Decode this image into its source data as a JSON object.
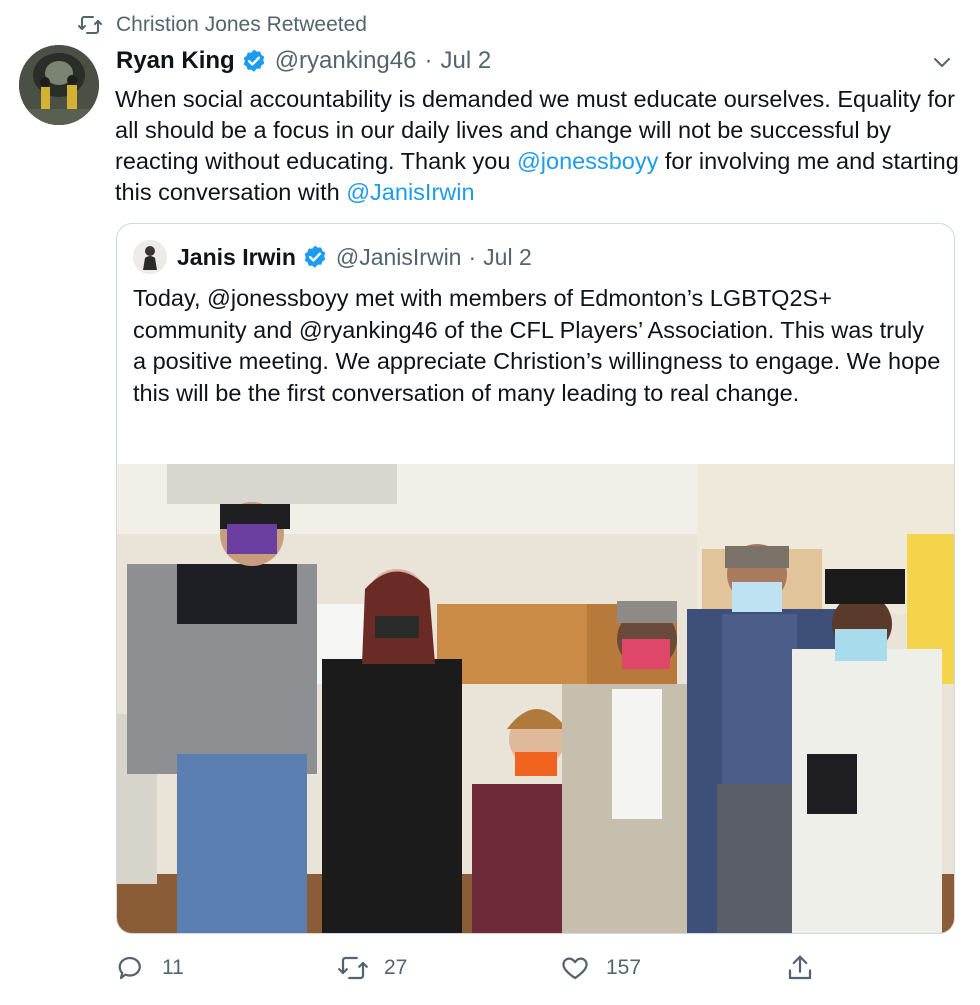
{
  "retweet": {
    "text": "Christion Jones Retweeted",
    "icon": "retweet-icon"
  },
  "tweet": {
    "author_name": "Ryan King",
    "handle": "@ryanking46",
    "separator": "·",
    "date": "Jul 2",
    "text_parts": [
      "When social accountability is demanded we must educate ourselves. Equality for all should be a focus in our daily lives and change will not be successful by reacting without educating. Thank you ",
      "@jonessboyy",
      " for involving me and starting this conversation with ",
      "@JanisIrwin"
    ]
  },
  "quote": {
    "author_name": "Janis Irwin",
    "handle": "@JanisIrwin",
    "separator": "·",
    "date": "Jul 2",
    "text": "Today, @jonessboyy met with members of Edmonton’s LGBTQ2S+ community and @ryanking46 of the CFL Players’ Association. This was truly a positive meeting. We appreciate Christion’s willingness to engage. We hope this will be the first conversation of many leading to real change."
  },
  "actions": {
    "reply_count": "11",
    "retweet_count": "27",
    "like_count": "157"
  },
  "colors": {
    "accent": "#1d9bf0",
    "secondary_text": "#536471",
    "border": "#cfd9de"
  }
}
